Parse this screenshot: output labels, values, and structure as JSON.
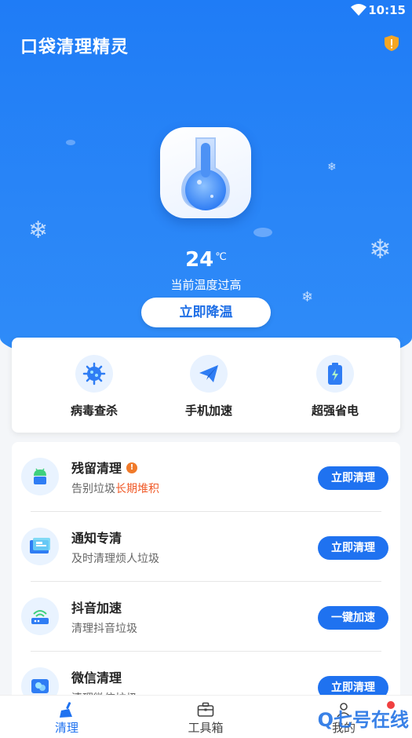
{
  "status_bar": {
    "time": "10:15",
    "wifi_icon": "wifi-icon"
  },
  "header": {
    "title": "口袋清理精灵",
    "shield_icon": "shield-warning-icon"
  },
  "hero": {
    "temperature_value": "24",
    "temperature_unit": "℃",
    "temperature_label": "当前温度过高",
    "cool_button_label": "立即降温",
    "colors": {
      "hero_blue": "#1f7cf6",
      "accent_blue": "#1f72f0"
    }
  },
  "quick_actions": [
    {
      "label": "病毒查杀",
      "icon": "virus-icon"
    },
    {
      "label": "手机加速",
      "icon": "paper-plane-icon"
    },
    {
      "label": "超强省电",
      "icon": "battery-icon"
    }
  ],
  "tasks": [
    {
      "title": "残留清理",
      "subtitle": "告别垃圾",
      "subtitle_highlight": "长期堆积",
      "button": "立即清理",
      "icon": "android-icon",
      "warning": "!"
    },
    {
      "title": "通知专清",
      "subtitle": "及时清理烦人垃圾",
      "button": "立即清理",
      "icon": "notification-icon"
    },
    {
      "title": "抖音加速",
      "subtitle": "清理抖音垃圾",
      "button": "一键加速",
      "icon": "router-icon"
    },
    {
      "title": "微信清理",
      "subtitle": "清理微信垃圾",
      "button": "立即清理",
      "icon": "wechat-icon"
    }
  ],
  "tab_bar": [
    {
      "label": "清理",
      "icon": "broom-icon",
      "active": true
    },
    {
      "label": "工具箱",
      "icon": "toolbox-icon",
      "active": false
    },
    {
      "label": "我的",
      "icon": "user-icon",
      "active": false
    }
  ],
  "watermark": "Q七号在线"
}
